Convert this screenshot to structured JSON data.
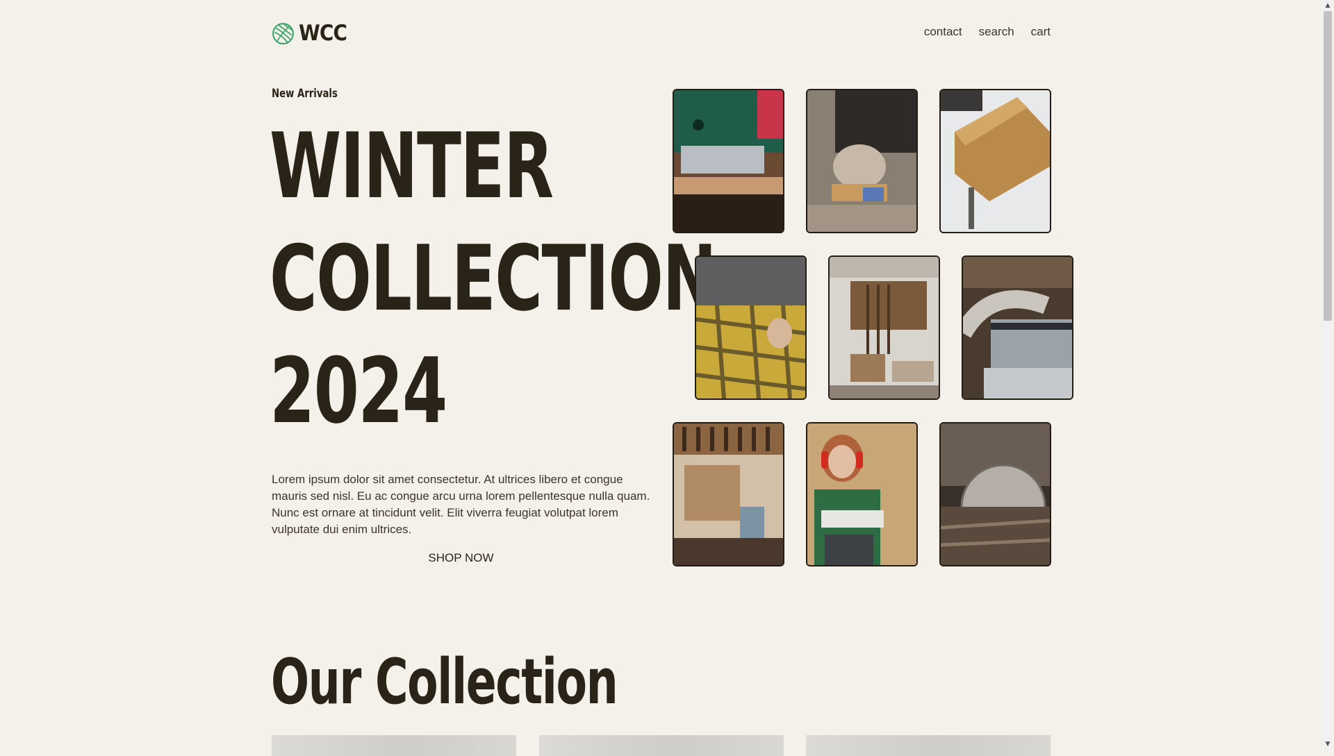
{
  "header": {
    "brand": "WCC",
    "nav": [
      {
        "label": "contact"
      },
      {
        "label": "search"
      },
      {
        "label": "cart"
      }
    ]
  },
  "hero": {
    "eyebrow": "New Arrivals",
    "title_lines": [
      "WINTER",
      "COLLECTION",
      "2024"
    ],
    "description": "Lorem ipsum dolor sit amet consectetur. At ultrices libero et congue mauris sed nisl. Eu ac congue arcu urna lorem pellentesque nulla quam. Nunc est ornare at tincidunt velit. Elit viverra feugiat volutpat lorem vulputate dui enim ultrices.",
    "cta": "SHOP NOW"
  },
  "gallery": [
    {
      "icon": "jigsaw-cutting-photo"
    },
    {
      "icon": "hand-sanding-photo"
    },
    {
      "icon": "wood-block-clamp-photo"
    },
    {
      "icon": "plaid-shirt-worker-photo"
    },
    {
      "icon": "workshop-interior-photo"
    },
    {
      "icon": "planer-machine-photo"
    },
    {
      "icon": "tool-wall-photo"
    },
    {
      "icon": "woman-ear-protection-photo"
    },
    {
      "icon": "table-saw-blade-photo"
    }
  ],
  "collection": {
    "title": "Our Collection"
  },
  "colors": {
    "background": "#f4f0ea",
    "text": "#2a2318",
    "logo_accent": "#3fa56a"
  }
}
